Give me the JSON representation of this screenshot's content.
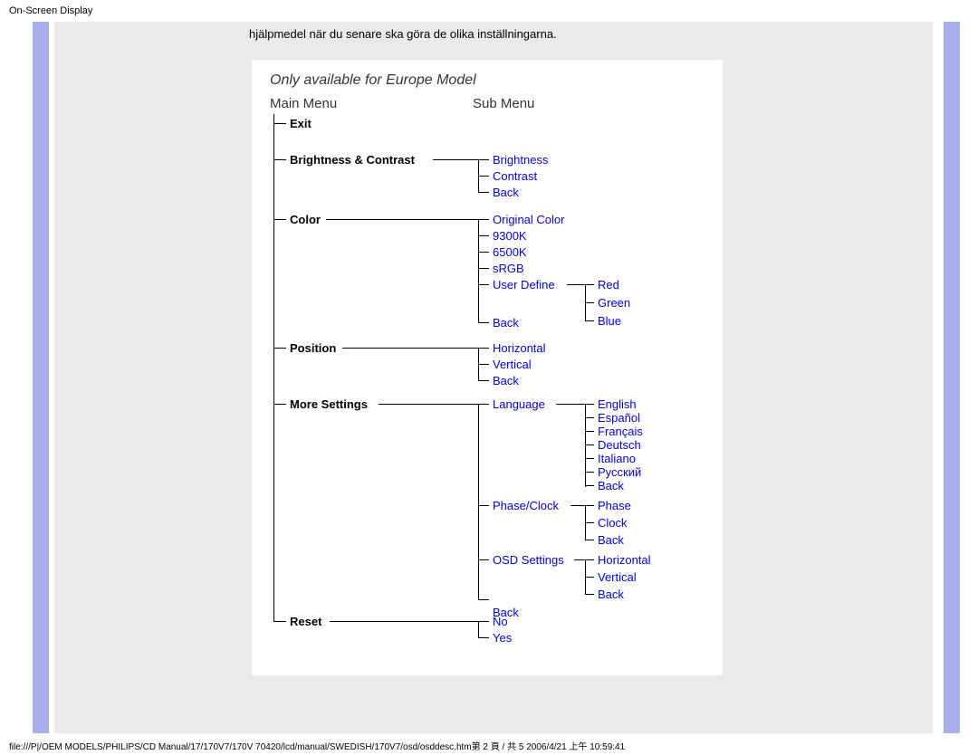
{
  "header": {
    "title": "On-Screen Display"
  },
  "intro": "hjälpmedel när du senare ska göra de olika inställningarna.",
  "footer": "file:///P|/OEM MODELS/PHILIPS/CD Manual/17/170V7/170V 70420/lcd/manual/SWEDISH/170V7/osd/osddesc.htm第 2 頁 / 共 5 2006/4/21 上午 10:59:41",
  "diagram": {
    "note": "Only available for Europe Model",
    "columns": {
      "main": "Main Menu",
      "sub": "Sub Menu"
    },
    "main_items": {
      "exit": "Exit",
      "brightness_contrast": "Brightness & Contrast",
      "color": "Color",
      "position": "Position",
      "more_settings": "More Settings",
      "reset": "Reset"
    },
    "bc_sub": {
      "brightness": "Brightness",
      "contrast": "Contrast",
      "back": "Back"
    },
    "color_sub": {
      "original": "Original Color",
      "k9300": "9300K",
      "k6500": "6500K",
      "srgb": "sRGB",
      "userdef": "User Define",
      "back": "Back"
    },
    "color_user_sub": {
      "red": "Red",
      "green": "Green",
      "blue": "Blue"
    },
    "position_sub": {
      "horizontal": "Horizontal",
      "vertical": "Vertical",
      "back": "Back"
    },
    "more_sub": {
      "language": "Language",
      "phaseclock": "Phase/Clock",
      "osdsettings": "OSD Settings",
      "back": "Back"
    },
    "language_sub": {
      "english": "English",
      "espanol": "Español",
      "francais": "Français",
      "deutsch": "Deutsch",
      "italiano": "Italiano",
      "russkiy": "Русский",
      "back": "Back"
    },
    "phaseclock_sub": {
      "phase": "Phase",
      "clock": "Clock",
      "back": "Back"
    },
    "osd_sub": {
      "horizontal": "Horizontal",
      "vertical": "Vertical",
      "back": "Back"
    },
    "reset_sub": {
      "no": "No",
      "yes": "Yes"
    }
  }
}
